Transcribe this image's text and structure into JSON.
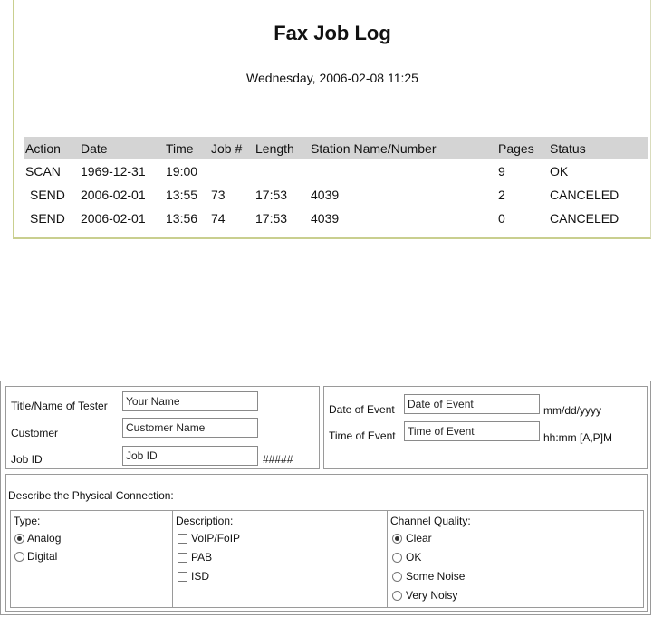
{
  "fax_log": {
    "title": "Fax Job Log",
    "datetime": "Wednesday, 2006-02-08 11:25",
    "columns": [
      "Action",
      "Date",
      "Time",
      "Job #",
      "Length",
      "Station Name/Number",
      "Pages",
      "Status"
    ],
    "rows": [
      [
        "SCAN",
        "1969-12-31",
        "19:00",
        "",
        "",
        "",
        "9",
        "OK"
      ],
      [
        "SEND",
        "2006-02-01",
        "13:55",
        "73",
        "17:53",
        "4039",
        "2",
        "CANCELED"
      ],
      [
        "SEND",
        "2006-02-01",
        "13:56",
        "74",
        "17:53",
        "4039",
        "0",
        "CANCELED"
      ]
    ]
  },
  "form": {
    "tester_label": "Title/Name of Tester",
    "tester_value": "Your Name",
    "customer_label": "Customer",
    "customer_value": "Customer Name",
    "jobid_label": "Job ID",
    "jobid_value": "Job ID",
    "jobid_hint": "#####",
    "event_date_label": "Date of Event",
    "event_date_value": "Date of Event",
    "event_date_hint": "mm/dd/yyyy",
    "event_time_label": "Time of Event",
    "event_time_value": "Time of Event",
    "event_time_hint": "hh:mm [A,P]M",
    "physical_label": "Describe the Physical Connection:",
    "type": {
      "label": "Type:",
      "options": [
        {
          "label": "Analog",
          "selected": true
        },
        {
          "label": "Digital",
          "selected": false
        }
      ]
    },
    "description": {
      "label": "Description:",
      "options": [
        {
          "label": "VoIP/FoIP",
          "checked": false
        },
        {
          "label": "PAB",
          "checked": false
        },
        {
          "label": "ISD",
          "checked": false
        }
      ]
    },
    "channel_quality": {
      "label": "Channel Quality:",
      "options": [
        {
          "label": "Clear",
          "selected": true
        },
        {
          "label": "OK",
          "selected": false
        },
        {
          "label": "Some Noise",
          "selected": false
        },
        {
          "label": "Very Noisy",
          "selected": false
        }
      ]
    }
  }
}
